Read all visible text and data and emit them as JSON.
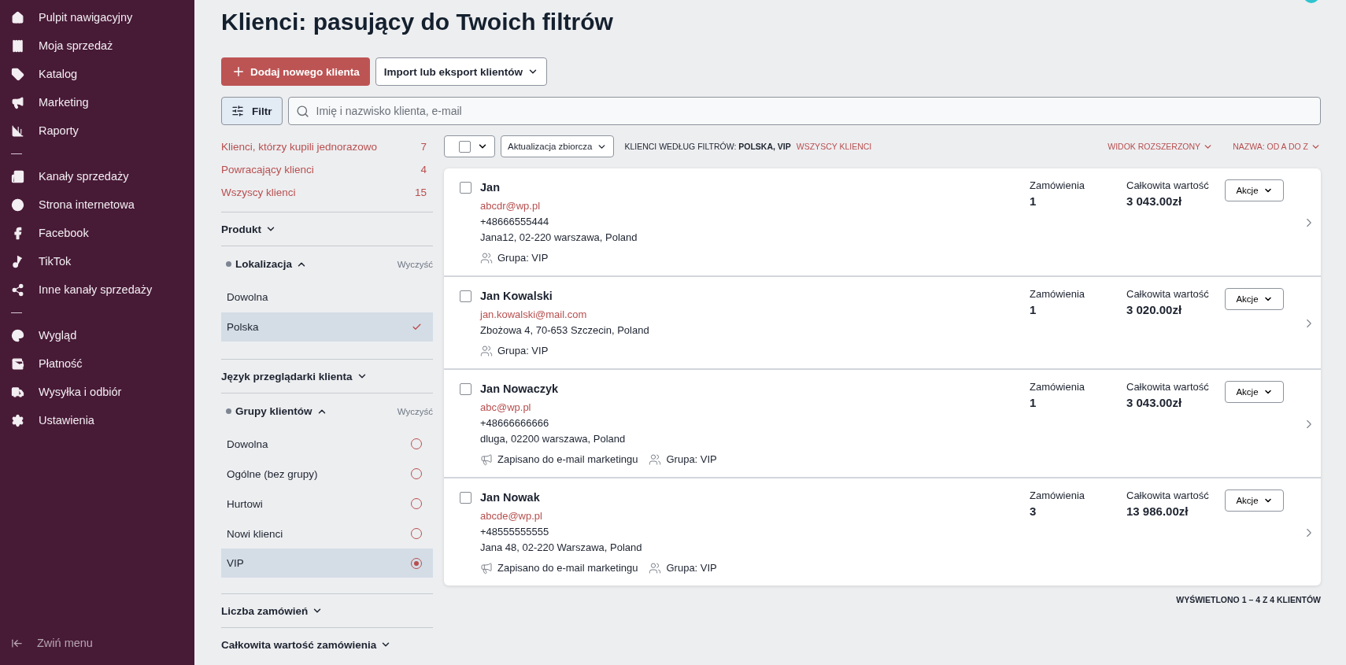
{
  "sidebar": {
    "items": [
      {
        "kind": "item",
        "label": "Pulpit nawigacyjny"
      },
      {
        "kind": "item",
        "label": "Moja sprzedaż"
      },
      {
        "kind": "item",
        "label": "Katalog"
      },
      {
        "kind": "item",
        "label": "Marketing"
      },
      {
        "kind": "item",
        "label": "Raporty"
      },
      {
        "kind": "separator"
      },
      {
        "kind": "item",
        "label": "Kanały sprzedaży"
      },
      {
        "kind": "item",
        "label": "Strona internetowa"
      },
      {
        "kind": "item",
        "label": "Facebook"
      },
      {
        "kind": "item",
        "label": "TikTok"
      },
      {
        "kind": "item",
        "label": "Inne kanały sprzedaży"
      },
      {
        "kind": "separator"
      },
      {
        "kind": "item",
        "label": "Wygląd"
      },
      {
        "kind": "item",
        "label": "Płatność"
      },
      {
        "kind": "item",
        "label": "Wysyłka i odbiór"
      },
      {
        "kind": "item",
        "label": "Ustawienia"
      }
    ],
    "collapse_label": "Zwiń menu"
  },
  "page": {
    "title": "Klienci: pasujący do Twoich filtrów",
    "add_button": "Dodaj nowego klienta",
    "import_button": "Import lub eksport klientów",
    "filter_button": "Filtr",
    "search": {
      "placeholder": "Imię i nazwisko klienta, e-mail"
    }
  },
  "segments": [
    {
      "label": "Klienci, którzy kupili jednorazowo",
      "count": "7"
    },
    {
      "label": "Powracający klienci",
      "count": "4"
    },
    {
      "label": "Wszyscy klienci",
      "count": "15"
    }
  ],
  "filters": [
    {
      "title": "Produkt",
      "expanded": false,
      "active": false
    },
    {
      "title": "Lokalizacja",
      "expanded": true,
      "active": true,
      "clear_label": "Wyczyść",
      "kind": "check",
      "options": [
        {
          "label": "Dowolna",
          "selected": false
        },
        {
          "label": "Polska",
          "selected": true
        }
      ]
    },
    {
      "title": "Język przeglądarki klienta",
      "expanded": false,
      "active": false
    },
    {
      "title": "Grupy klientów",
      "expanded": true,
      "active": true,
      "clear_label": "Wyczyść",
      "kind": "radio",
      "options": [
        {
          "label": "Dowolna",
          "selected": false
        },
        {
          "label": "Ogólne (bez grupy)",
          "selected": false
        },
        {
          "label": "Hurtowi",
          "selected": false
        },
        {
          "label": "Nowi klienci",
          "selected": false
        },
        {
          "label": "VIP",
          "selected": true
        }
      ]
    },
    {
      "title": "Liczba zamówień",
      "expanded": false,
      "active": false
    },
    {
      "title": "Całkowita wartość zamówienia",
      "expanded": false,
      "active": false
    }
  ],
  "toolbar": {
    "select_all_checked": false,
    "bulk_button": "Aktualizacja zbiorcza",
    "summary": "KLIENCI WEDŁUG FILTRÓW: **POLSKA, VIP**",
    "all_link": "WSZYSCY KLIENCI",
    "view": "WIDOK ROZSZERZONY",
    "sort": "NAZWA: OD A DO Z"
  },
  "customers": [
    {
      "name": "Jan",
      "checked": false,
      "email": "abcdr@wp.pl",
      "phone": "+48666555444",
      "address": "Jana12, 02-220 warszawa, Poland",
      "tags": [
        {
          "kind": "group",
          "label": "Grupa: VIP"
        }
      ],
      "orders_label": "Zamówienia",
      "orders": "1",
      "total_label": "Całkowita wartość",
      "total": "3 043.00zł",
      "actions": "Akcje"
    },
    {
      "name": "Jan Kowalski",
      "checked": false,
      "email": "jan.kowalski@mail.com",
      "address": "Zbożowa 4, 70-653 Szczecin, Poland",
      "tags": [
        {
          "kind": "group",
          "label": "Grupa: VIP"
        }
      ],
      "orders_label": "Zamówienia",
      "orders": "1",
      "total_label": "Całkowita wartość",
      "total": "3 020.00zł",
      "actions": "Akcje"
    },
    {
      "name": "Jan Nowaczyk",
      "checked": false,
      "email": "abc@wp.pl",
      "phone": "+48666666666",
      "address": "dluga, 02200 warszawa, Poland",
      "tags": [
        {
          "kind": "marketing",
          "label": "Zapisano do e-mail marketingu"
        },
        {
          "kind": "group",
          "label": "Grupa: VIP"
        }
      ],
      "orders_label": "Zamówienia",
      "orders": "1",
      "total_label": "Całkowita wartość",
      "total": "3 043.00zł",
      "actions": "Akcje"
    },
    {
      "name": "Jan Nowak",
      "checked": false,
      "email": "abcde@wp.pl",
      "phone": "+48555555555",
      "address": "Jana 48, 02-220 Warszawa, Poland",
      "tags": [
        {
          "kind": "marketing",
          "label": "Zapisano do e-mail marketingu"
        },
        {
          "kind": "group",
          "label": "Grupa: VIP"
        }
      ],
      "orders_label": "Zamówienia",
      "orders": "3",
      "total_label": "Całkowita wartość",
      "total": "13 986.00zł",
      "actions": "Akcje"
    }
  ],
  "footer": "WYŚWIETLONO 1 – 4 Z 4 KLIENTÓW"
}
